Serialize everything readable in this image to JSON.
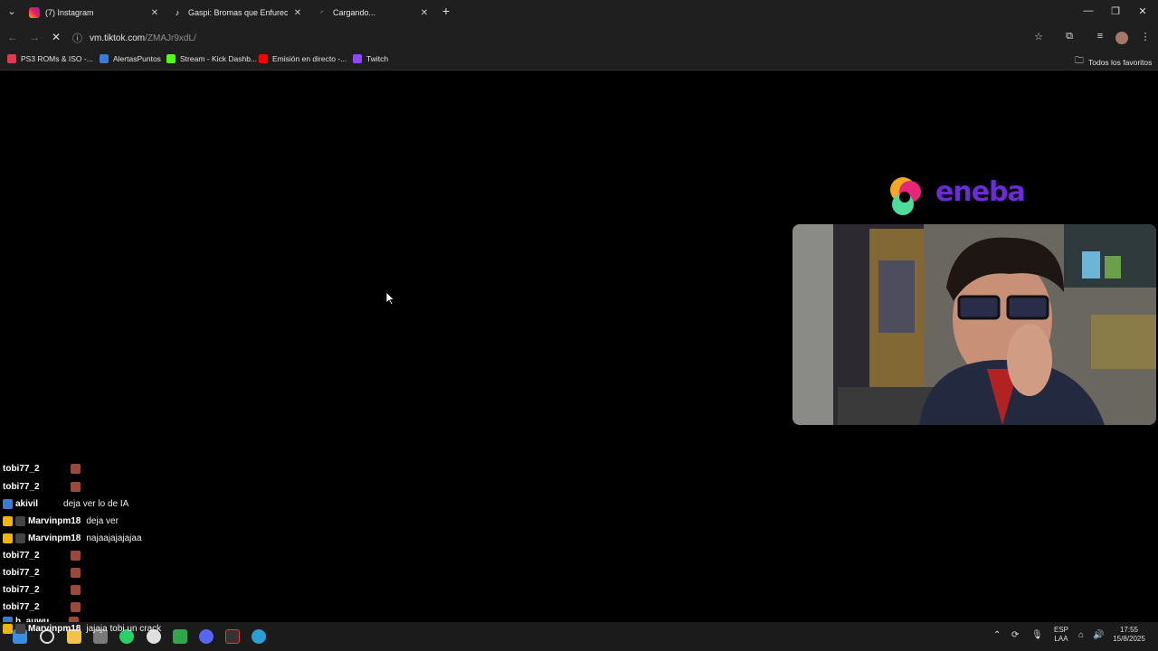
{
  "tabs": [
    {
      "title": "(7) Instagram",
      "icon": "instagram-icon"
    },
    {
      "title": "Gaspi: Bromas que Enfurecen e",
      "icon": "tiktok-icon"
    },
    {
      "title": "Cargando...",
      "icon": "loading-icon"
    }
  ],
  "address": {
    "host": "vm.tiktok.com",
    "path": "/ZMAJr9xdL/"
  },
  "bookmarks": [
    {
      "label": "PS3 ROMs & ISO -...",
      "color": "#e23b4f"
    },
    {
      "label": "AlertasPuntos",
      "color": "#3a7bd5"
    },
    {
      "label": "Stream - Kick Dashb...",
      "color": "#53fc18"
    },
    {
      "label": "Emisión en directo -...",
      "color": "#ff0000"
    },
    {
      "label": "Twitch",
      "color": "#9146ff"
    }
  ],
  "bookmarks_all": "Todos los favoritos",
  "overlay": {
    "brand": "eneba",
    "brand_color": "#6b2bd6"
  },
  "chat": [
    {
      "user": "tobi77_2",
      "text": "",
      "emote": true,
      "badges": []
    },
    {
      "user": "tobi77_2",
      "text": "",
      "emote": true,
      "badges": []
    },
    {
      "user": "akivil",
      "text": "deja ver lo de IA",
      "emote": false,
      "badges": [
        "#3a7bd5"
      ]
    },
    {
      "user": "Marvinpm18",
      "text": "deja ver",
      "emote": false,
      "badges": [
        "#f5b400",
        "#444"
      ]
    },
    {
      "user": "Marvinpm18",
      "text": "najaajajajajaa",
      "emote": false,
      "badges": [
        "#f5b400",
        "#444"
      ]
    },
    {
      "user": "tobi77_2",
      "text": "",
      "emote": true,
      "badges": []
    },
    {
      "user": "tobi77_2",
      "text": "",
      "emote": true,
      "badges": []
    },
    {
      "user": "tobi77_2",
      "text": "",
      "emote": true,
      "badges": []
    },
    {
      "user": "tobi77_2",
      "text": "",
      "emote": true,
      "badges": []
    },
    {
      "user": "h_auwu",
      "text": "",
      "emote": true,
      "badges": [
        "#3a7bd5"
      ]
    },
    {
      "user": "Marvinpm18",
      "text": "jajaja tobi un crack",
      "emote": false,
      "badges": [
        "#f5b400",
        "#444"
      ]
    }
  ],
  "tray": {
    "lang_top": "ESP",
    "lang_bottom": "LAA",
    "time": "17:55",
    "date": "15/8/2025"
  }
}
